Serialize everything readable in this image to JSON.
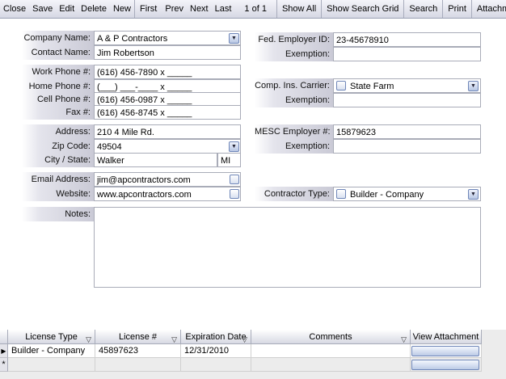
{
  "toolbar": {
    "close": "Close",
    "save": "Save",
    "edit": "Edit",
    "delete": "Delete",
    "new": "New",
    "first": "First",
    "prev": "Prev",
    "next": "Next",
    "last": "Last",
    "record": "1 of 1",
    "show_all": "Show All",
    "show_search_grid": "Show Search Grid",
    "search": "Search",
    "print": "Print",
    "attachments": "Attachments"
  },
  "form": {
    "company_name_label": "Company Name:",
    "company_name": "A & P Contractors",
    "contact_name_label": "Contact Name:",
    "contact_name": "Jim Robertson",
    "work_phone_label": "Work Phone #:",
    "work_phone": "(616) 456-7890 x _____",
    "home_phone_label": "Home Phone #:",
    "home_phone": "(___) ___-____ x _____",
    "cell_phone_label": "Cell Phone #:",
    "cell_phone": "(616) 456-0987 x _____",
    "fax_label": "Fax #:",
    "fax": "(616) 456-8745 x _____",
    "address_label": "Address:",
    "address": "210 4 Mile Rd.",
    "zip_label": "Zip Code:",
    "zip": "49504",
    "city_state_label": "City / State:",
    "city": "Walker",
    "state": "MI",
    "email_label": "Email Address:",
    "email": "jim@apcontractors.com",
    "website_label": "Website:",
    "website": "www.apcontractors.com",
    "notes_label": "Notes:",
    "notes": "",
    "fed_employer_label": "Fed. Employer ID:",
    "fed_employer": "23-45678910",
    "exemption_label": "Exemption:",
    "exemption1": "",
    "comp_ins_label": "Comp. Ins. Carrier:",
    "comp_ins": "State Farm",
    "exemption2": "",
    "mesc_label": "MESC Employer #:",
    "mesc": "15879623",
    "exemption3": "",
    "contractor_type_label": "Contractor Type:",
    "contractor_type": "Builder - Company"
  },
  "grid": {
    "headers": {
      "license_type": "License Type",
      "license_num": "License #",
      "expiration": "Expiration Date",
      "comments": "Comments",
      "view_attachment": "View Attachment"
    },
    "rows": [
      {
        "license_type": "Builder - Company",
        "license_num": "45897623",
        "expiration": "12/31/2010",
        "comments": ""
      }
    ],
    "new_row_marker": "*"
  }
}
